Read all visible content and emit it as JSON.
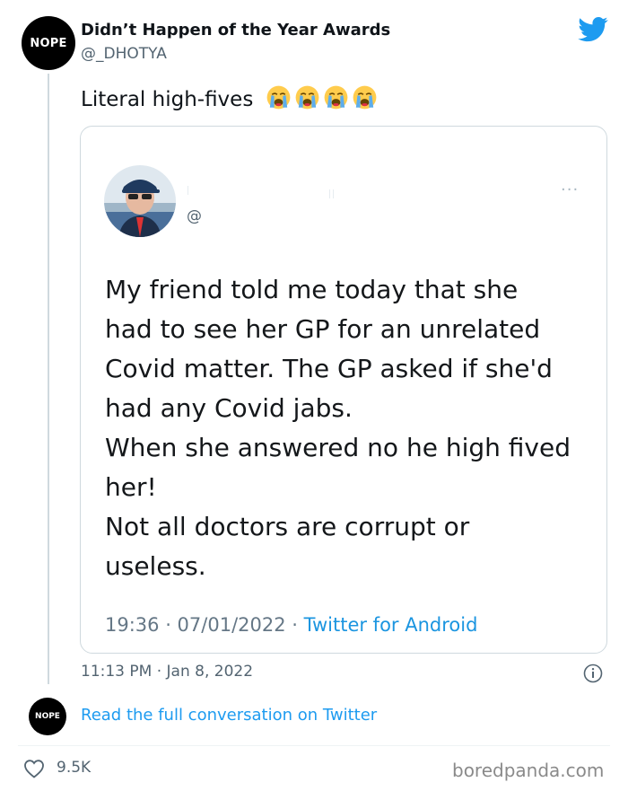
{
  "author": {
    "avatar_text": "NOPE",
    "display_name": "Didn’t Happen of the Year Awards",
    "handle": "@_DHOTYA"
  },
  "tweet": {
    "text": "Literal high-fives",
    "emojis": [
      "loudly-crying-face",
      "loudly-crying-face",
      "loudly-crying-face",
      "loudly-crying-face"
    ],
    "timestamp": "11:13 PM · Jan 8, 2022"
  },
  "embedded_tweet": {
    "handle": "@",
    "more_label": "···",
    "body_lines": [
      "My friend told me today that she",
      "had to see her GP for an unrelated",
      "Covid matter. The GP asked if she'd",
      "had any Covid jabs.",
      "When she answered no he high fived",
      "her!",
      "Not all doctors are corrupt or",
      "useless."
    ],
    "time_date": "19:36 · 07/01/2022 ·",
    "source": "Twitter for Android"
  },
  "footer": {
    "small_avatar_text": "NOPE",
    "read_full_link": "Read the full conversation on Twitter",
    "like_count": "9.5K",
    "watermark": "boredpanda.com"
  },
  "colors": {
    "twitter_blue": "#1d9bf0",
    "embed_link_blue": "#1b95e0",
    "secondary_text": "#536471",
    "border": "#cfd9de"
  }
}
